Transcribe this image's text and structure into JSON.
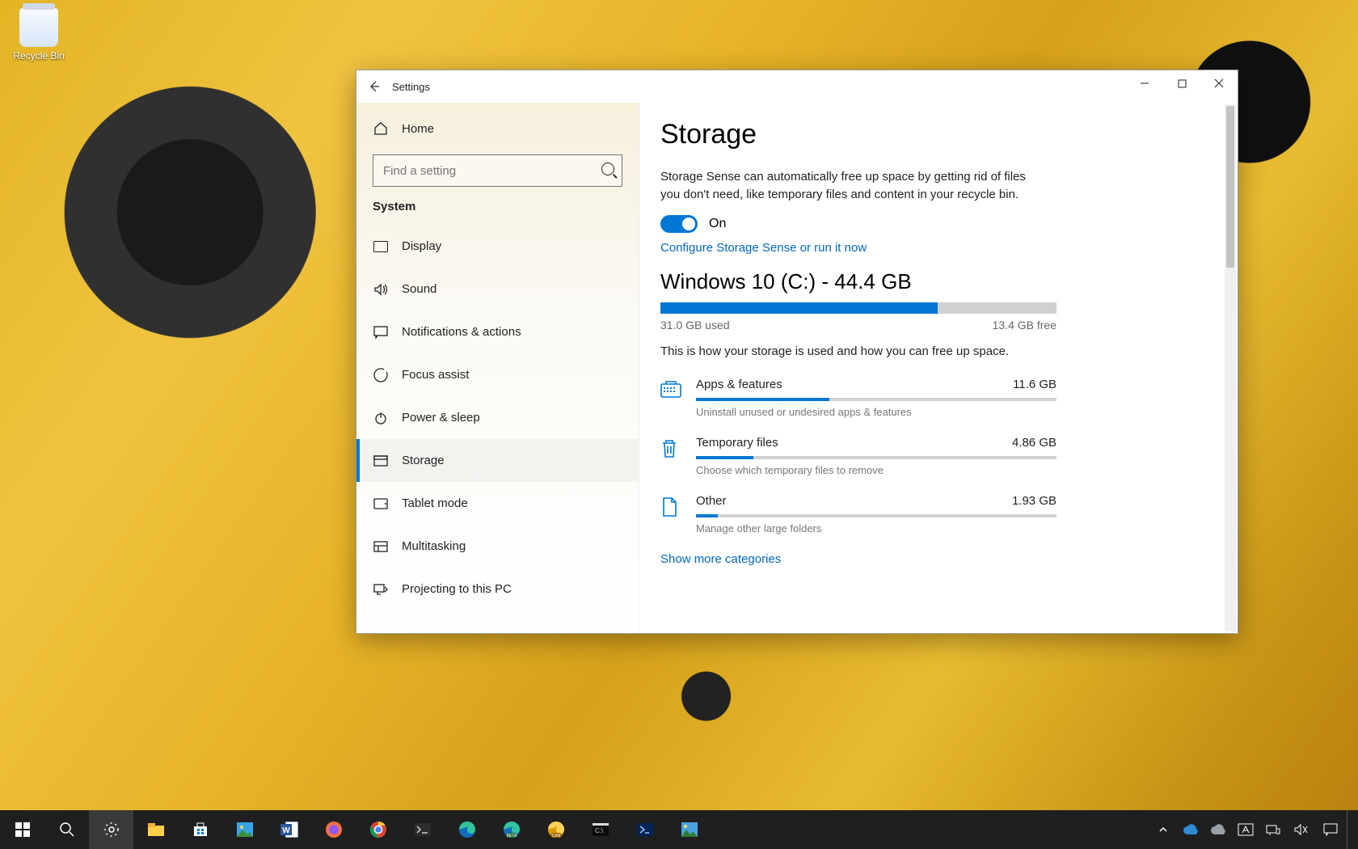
{
  "desktop": {
    "recycle_bin": "Recycle Bin"
  },
  "window": {
    "title": "Settings",
    "home": "Home",
    "search_placeholder": "Find a setting",
    "category": "System",
    "nav": [
      {
        "label": "Display",
        "icon": "display-icon"
      },
      {
        "label": "Sound",
        "icon": "sound-icon"
      },
      {
        "label": "Notifications & actions",
        "icon": "notifications-icon"
      },
      {
        "label": "Focus assist",
        "icon": "focus-icon"
      },
      {
        "label": "Power & sleep",
        "icon": "power-icon"
      },
      {
        "label": "Storage",
        "icon": "storage-icon"
      },
      {
        "label": "Tablet mode",
        "icon": "tablet-icon"
      },
      {
        "label": "Multitasking",
        "icon": "multitasking-icon"
      },
      {
        "label": "Projecting to this PC",
        "icon": "projecting-icon"
      }
    ],
    "active_nav_index": 5
  },
  "main": {
    "heading": "Storage",
    "sense_desc": "Storage Sense can automatically free up space by getting rid of files you don't need, like temporary files and content in your recycle bin.",
    "toggle_label": "On",
    "configure_link": "Configure Storage Sense or run it now",
    "drive": {
      "title": "Windows 10 (C:) - 44.4 GB",
      "used_pct": 70,
      "used_label": "31.0 GB used",
      "free_label": "13.4 GB free"
    },
    "usage_desc": "This is how your storage is used and how you can free up space.",
    "categories": [
      {
        "name": "Apps & features",
        "size": "11.6 GB",
        "pct": 37,
        "sub": "Uninstall unused or undesired apps & features",
        "icon": "apps-icon"
      },
      {
        "name": "Temporary files",
        "size": "4.86 GB",
        "pct": 16,
        "sub": "Choose which temporary files to remove",
        "icon": "trash-icon"
      },
      {
        "name": "Other",
        "size": "1.93 GB",
        "pct": 6,
        "sub": "Manage other large folders",
        "icon": "other-icon"
      }
    ],
    "show_more": "Show more categories"
  },
  "colors": {
    "accent": "#0078d4",
    "link": "#0067c0"
  }
}
